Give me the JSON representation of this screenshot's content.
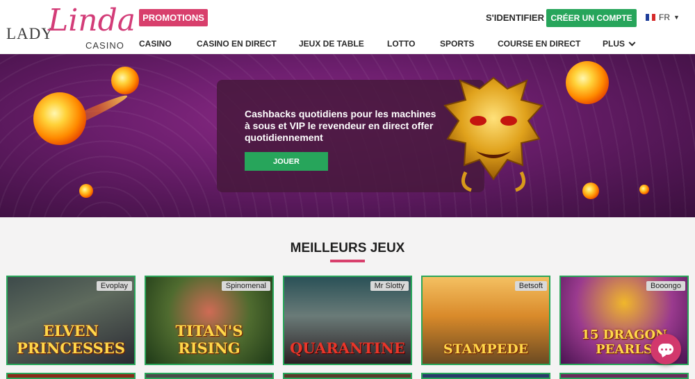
{
  "logo": {
    "lady": "LADY",
    "linda": "Linda",
    "casino": "CASINO"
  },
  "header": {
    "promotions": "PROMOTIONS",
    "login": "S'IDENTIFIER",
    "register": "CRÉER UN COMPTE",
    "language": "FR"
  },
  "nav": [
    "CASINO",
    "CASINO EN DIRECT",
    "JEUX DE TABLE",
    "LOTTO",
    "SPORTS",
    "COURSE EN DIRECT",
    "PLUS"
  ],
  "hero": {
    "text": "Cashbacks quotidiens pour les machines à sous et VIP le revendeur en direct offer quotidiennement",
    "button": "JOUER"
  },
  "section": {
    "title": "MEILLEURS JEUX"
  },
  "games": [
    {
      "name": "ELVEN PRINCESSES",
      "provider": "Evoplay"
    },
    {
      "name": "TITAN'S RISING",
      "provider": "Spinomenal"
    },
    {
      "name": "QUARANTINE",
      "provider": "Mr Slotty"
    },
    {
      "name": "STAMPEDE",
      "provider": "Betsoft"
    },
    {
      "name": "15 DRAGON PEARLS",
      "provider": "Booongo"
    }
  ],
  "colors": {
    "accent": "#d83f6c",
    "green": "#27a55b",
    "hero": "#6e1f6f"
  }
}
